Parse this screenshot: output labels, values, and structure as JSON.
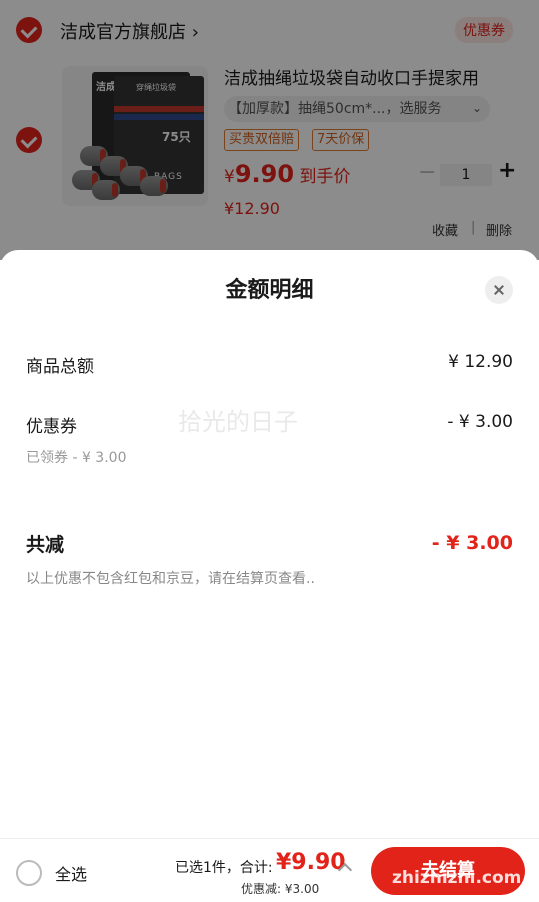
{
  "shop": {
    "name": "洁成官方旗舰店 ›",
    "coupon_tag": "优惠券"
  },
  "product": {
    "title": "洁成抽绳垃圾袋自动收口手提家用",
    "spec": "【加厚款】抽绳50cm*...，选服务",
    "spec_arrow": "⌄",
    "tags": [
      "买贵双倍赔",
      "7天价保"
    ],
    "price_currency": "¥",
    "price_hand": "9.90",
    "price_hand_suffix": "到手价",
    "price_original": "¥12.90",
    "quantity": "1",
    "image": {
      "brand": "洁成",
      "package_title": "穿绳垃圾袋",
      "count": "75只",
      "bags_text": "BAGS"
    },
    "actions": [
      "收藏",
      "删除"
    ],
    "action_separator": "|"
  },
  "sheet": {
    "title": "金额明细",
    "rows": [
      {
        "label": "商品总额",
        "value": "¥ 12.90"
      },
      {
        "label": "优惠券",
        "value": "- ¥ 3.00",
        "sub": "已领券 - ¥ 3.00"
      }
    ],
    "watermark": "拾光的日子",
    "total_label": "共减",
    "total_value": "- ¥ 3.00",
    "note": "以上优惠不包含红包和京豆，请在结算页查看.."
  },
  "bottom_bar": {
    "select_all": "全选",
    "selected_summary": "已选1件，合计:",
    "total": "¥9.90",
    "discount": "优惠减:  ¥3.00",
    "checkout": "去结算"
  },
  "corner_watermark": "zhizhizhi.com",
  "colors": {
    "accent": "#e2231a",
    "tag_orange": "#d2601a"
  }
}
